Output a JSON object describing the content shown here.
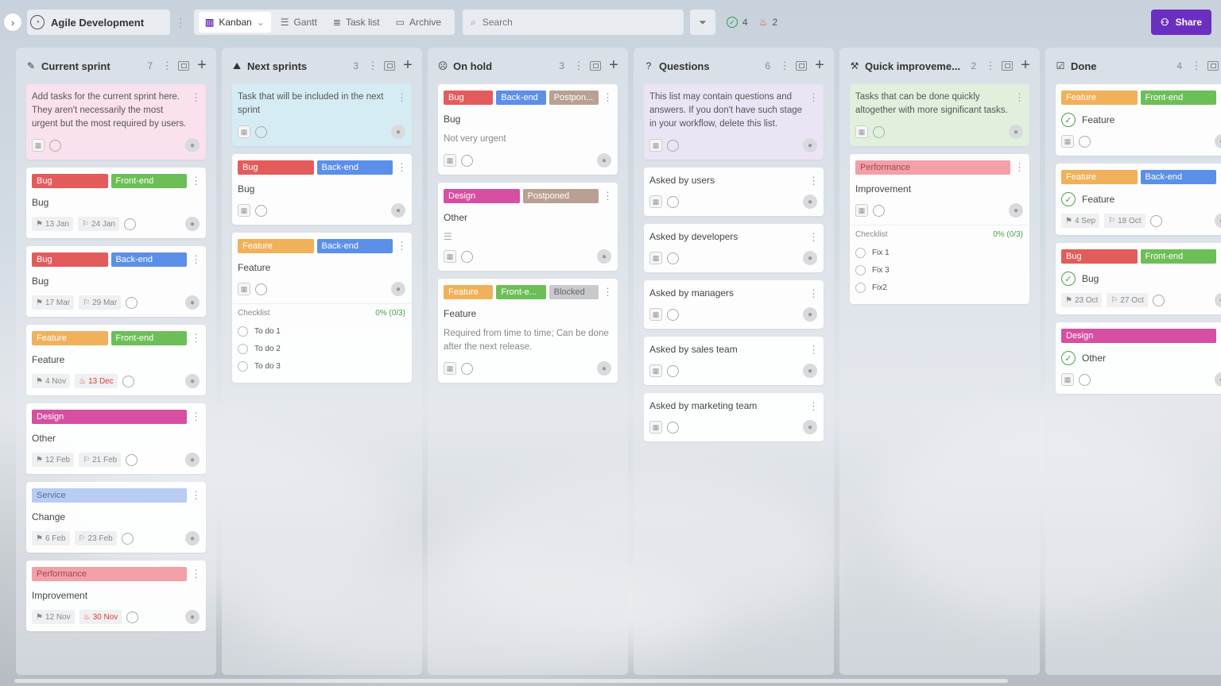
{
  "header": {
    "project_title": "Agile Development",
    "views": [
      {
        "label": "Kanban",
        "active": true,
        "icon": "kanban-icon"
      },
      {
        "label": "Gantt",
        "active": false,
        "icon": "gantt-icon"
      },
      {
        "label": "Task list",
        "active": false,
        "icon": "list-icon"
      },
      {
        "label": "Archive",
        "active": false,
        "icon": "archive-icon"
      }
    ],
    "search_placeholder": "Search",
    "completed_count": "4",
    "overdue_count": "2",
    "share_label": "Share",
    "accent_color": "#6b2fbf"
  },
  "columns": [
    {
      "title": "Current sprint",
      "icon": "✎",
      "count": "7",
      "cards": [
        {
          "note": "Add tasks for the current sprint here. They aren't necessarily the most urgent but the most required by users.",
          "style": "note-pink"
        },
        {
          "tags": [
            [
              "Bug",
              "bug"
            ],
            [
              "Front-end",
              "frontend"
            ]
          ],
          "title": "Bug",
          "dates": [
            [
              "13 Jan",
              ""
            ],
            [
              "24 Jan",
              ""
            ]
          ]
        },
        {
          "tags": [
            [
              "Bug",
              "bug"
            ],
            [
              "Back-end",
              "backend"
            ]
          ],
          "title": "Bug",
          "dates": [
            [
              "17 Mar",
              ""
            ],
            [
              "29 Mar",
              ""
            ]
          ]
        },
        {
          "tags": [
            [
              "Feature",
              "feature"
            ],
            [
              "Front-end",
              "frontend"
            ]
          ],
          "title": "Feature",
          "dates": [
            [
              "4 Nov",
              ""
            ],
            [
              "13 Dec",
              "red"
            ]
          ]
        },
        {
          "tags": [
            [
              "Design",
              "design"
            ]
          ],
          "title": "Other",
          "dates": [
            [
              "12 Feb",
              ""
            ],
            [
              "21 Feb",
              ""
            ]
          ]
        },
        {
          "tags": [
            [
              "Service",
              "service"
            ]
          ],
          "title": "Change",
          "dates": [
            [
              "6 Feb",
              ""
            ],
            [
              "23 Feb",
              ""
            ]
          ]
        },
        {
          "tags": [
            [
              "Performance",
              "performance"
            ]
          ],
          "title": "Improvement",
          "dates": [
            [
              "12 Nov",
              ""
            ],
            [
              "30 Nov",
              "red"
            ]
          ]
        }
      ]
    },
    {
      "title": "Next sprints",
      "icon": "⛰",
      "count": "3",
      "cards": [
        {
          "note": "Task that will be included in the next sprint",
          "style": "note-blue"
        },
        {
          "tags": [
            [
              "Bug",
              "bug"
            ],
            [
              "Back-end",
              "backend"
            ]
          ],
          "title": "Bug"
        },
        {
          "tags": [
            [
              "Feature",
              "feature"
            ],
            [
              "Back-end",
              "backend"
            ]
          ],
          "title": "Feature",
          "checklist": {
            "label": "Checklist",
            "progress": "0% (0/3)",
            "items": [
              "To do 1",
              "To do 2",
              "To do 3"
            ]
          }
        }
      ]
    },
    {
      "title": "On hold",
      "icon": "☹",
      "count": "3",
      "cards": [
        {
          "tags": [
            [
              "Bug",
              "bug"
            ],
            [
              "Back-end",
              "backend"
            ],
            [
              "Postpon...",
              "postponed"
            ]
          ],
          "title": "Bug",
          "sub": "Not very urgent"
        },
        {
          "tags": [
            [
              "Design",
              "design"
            ],
            [
              "Postponed",
              "postponed"
            ]
          ],
          "title": "Other",
          "lines": true
        },
        {
          "tags": [
            [
              "Feature",
              "feature"
            ],
            [
              "Front-e...",
              "frontend"
            ],
            [
              "Blocked",
              "blocked"
            ]
          ],
          "title": "Feature",
          "sub": "Required from time to time; Can be done after the next release."
        }
      ]
    },
    {
      "title": "Questions",
      "icon": "?",
      "count": "6",
      "cards": [
        {
          "note": "This list may contain questions and answers. If you don't have such stage in your workflow, delete this list.",
          "style": "note-purple"
        },
        {
          "title": "Asked by users"
        },
        {
          "title": "Asked by developers"
        },
        {
          "title": "Asked by managers"
        },
        {
          "title": "Asked by sales team"
        },
        {
          "title": "Asked by marketing team"
        }
      ]
    },
    {
      "title": "Quick improveme...",
      "icon": "⚒",
      "count": "2",
      "cards": [
        {
          "note": "Tasks that can be done quickly altogether with more significant tasks.",
          "style": "note-green"
        },
        {
          "tags": [
            [
              "Performance",
              "performance"
            ]
          ],
          "title": "Improvement",
          "checklist": {
            "label": "Checklist",
            "progress": "0% (0/3)",
            "items": [
              "Fix 1",
              "Fix 3",
              "Fix2"
            ]
          }
        }
      ]
    },
    {
      "title": "Done",
      "icon": "☑",
      "count": "4",
      "cards": [
        {
          "tags": [
            [
              "Feature",
              "feature"
            ],
            [
              "Front-end",
              "frontend"
            ]
          ],
          "title": "Feature",
          "done": true
        },
        {
          "tags": [
            [
              "Feature",
              "feature"
            ],
            [
              "Back-end",
              "backend"
            ]
          ],
          "title": "Feature",
          "done": true,
          "dates": [
            [
              "4 Sep",
              ""
            ],
            [
              "18 Oct",
              ""
            ]
          ]
        },
        {
          "tags": [
            [
              "Bug",
              "bug"
            ],
            [
              "Front-end",
              "frontend"
            ]
          ],
          "title": "Bug",
          "done": true,
          "dates": [
            [
              "23 Oct",
              ""
            ],
            [
              "27 Oct",
              ""
            ]
          ]
        },
        {
          "tags": [
            [
              "Design",
              "design"
            ]
          ],
          "title": "Other",
          "done": true
        }
      ]
    }
  ]
}
